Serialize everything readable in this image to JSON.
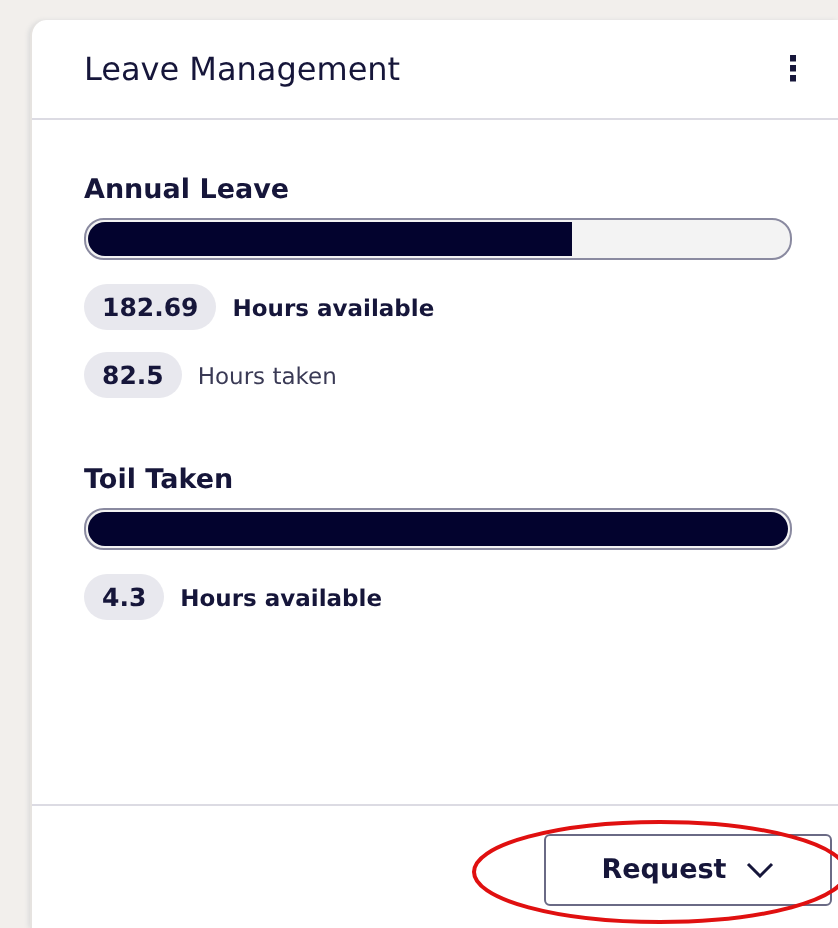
{
  "card": {
    "title": "Leave Management",
    "menu_icon": "⋮"
  },
  "sections": [
    {
      "title": "Annual Leave",
      "level": 0.69,
      "stats": [
        {
          "value": "182.69",
          "label": "Hours available",
          "emphasis": true
        },
        {
          "value": "82.5",
          "label": "Hours taken",
          "emphasis": false
        }
      ]
    },
    {
      "title": "Toil Taken",
      "level": 1.0,
      "stats": [
        {
          "value": "4.3",
          "label": "Hours available",
          "emphasis": true
        }
      ]
    }
  ],
  "footer": {
    "button": {
      "label": "Request",
      "circled": true
    }
  }
}
